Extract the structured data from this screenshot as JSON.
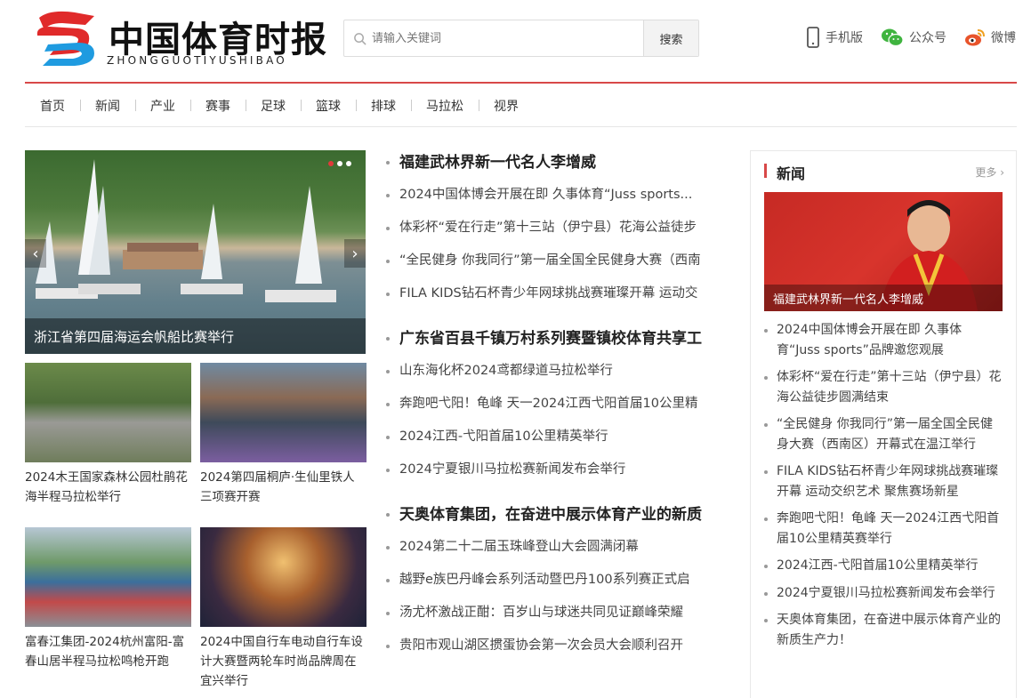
{
  "brand": {
    "title": "中国体育时报",
    "subtitle": "ZHONGGUOTIYUSHIBAO"
  },
  "search": {
    "placeholder": "请输入关键词",
    "button": "搜索"
  },
  "top_links": [
    {
      "label": "手机版",
      "icon": "phone-icon"
    },
    {
      "label": "公众号",
      "icon": "wechat-icon"
    },
    {
      "label": "微博",
      "icon": "weibo-icon"
    }
  ],
  "nav": [
    "首页",
    "新闻",
    "产业",
    "赛事",
    "足球",
    "篮球",
    "排球",
    "马拉松",
    "视界"
  ],
  "hero": {
    "caption": "浙江省第四届海运会帆船比赛举行",
    "prev_icon": "chevron-left-icon",
    "next_icon": "chevron-right-icon"
  },
  "thumbs": [
    {
      "title": "2024木王国家森林公园杜鹃花海半程马拉松举行"
    },
    {
      "title": "2024第四届桐庐·生仙里铁人三项赛开赛"
    },
    {
      "title": "富春江集团-2024杭州富阳-富春山居半程马拉松鸣枪开跑"
    },
    {
      "title": "2024中国自行车电动自行车设计大赛暨两轮车时尚品牌周在宜兴举行"
    }
  ],
  "middle": [
    {
      "head": "福建武林界新一代名人李增威",
      "items": [
        "2024中国体博会开展在即 久事体育“Juss sports...",
        "体彩杯“爱在行走”第十三站（伊宁县）花海公益徒步",
        "“全民健身 你我同行”第一届全国全民健身大赛（西南",
        "FILA KIDS钻石杯青少年网球挑战赛璀璨开幕 运动交"
      ]
    },
    {
      "head": "广东省百县千镇万村系列赛暨镇校体育共享工",
      "items": [
        "山东海化杯2024鸢都绿道马拉松举行",
        "奔跑吧弋阳！龟峰 天一2024江西弋阳首届10公里精",
        "2024江西-弋阳首届10公里精英举行",
        "2024宁夏银川马拉松赛新闻发布会举行"
      ]
    },
    {
      "head": "天奥体育集团，在奋进中展示体育产业的新质",
      "items": [
        "2024第二十二届玉珠峰登山大会圆满闭幕",
        "越野e族巴丹峰会系列活动暨巴丹100系列赛正式启",
        "汤尤杯激战正酣：百岁山与球迷共同见证巅峰荣耀",
        "贵阳市观山湖区掼蛋协会第一次会员大会顺利召开"
      ]
    }
  ],
  "side": {
    "title": "新闻",
    "more": "更多",
    "feature_caption": "福建武林界新一代名人李增威",
    "items": [
      "2024中国体博会开展在即 久事体育“Juss sports”品牌邀您观展",
      "体彩杯“爱在行走”第十三站（伊宁县）花海公益徒步圆满结束",
      "“全民健身 你我同行”第一届全国全民健身大赛（西南区）开幕式在温江举行",
      "FILA KIDS钻石杯青少年网球挑战赛璀璨开幕 运动交织艺术 聚焦赛场新星",
      "奔跑吧弋阳！龟峰 天一2024江西弋阳首届10公里精英赛举行",
      "2024江西-弋阳首届10公里精英举行",
      "2024宁夏银川马拉松赛新闻发布会举行",
      "天奥体育集团，在奋进中展示体育产业的新质生产力！"
    ]
  },
  "colors": {
    "accent": "#d84848",
    "logo_red": "#e02a2a",
    "logo_blue": "#1f9be0"
  }
}
